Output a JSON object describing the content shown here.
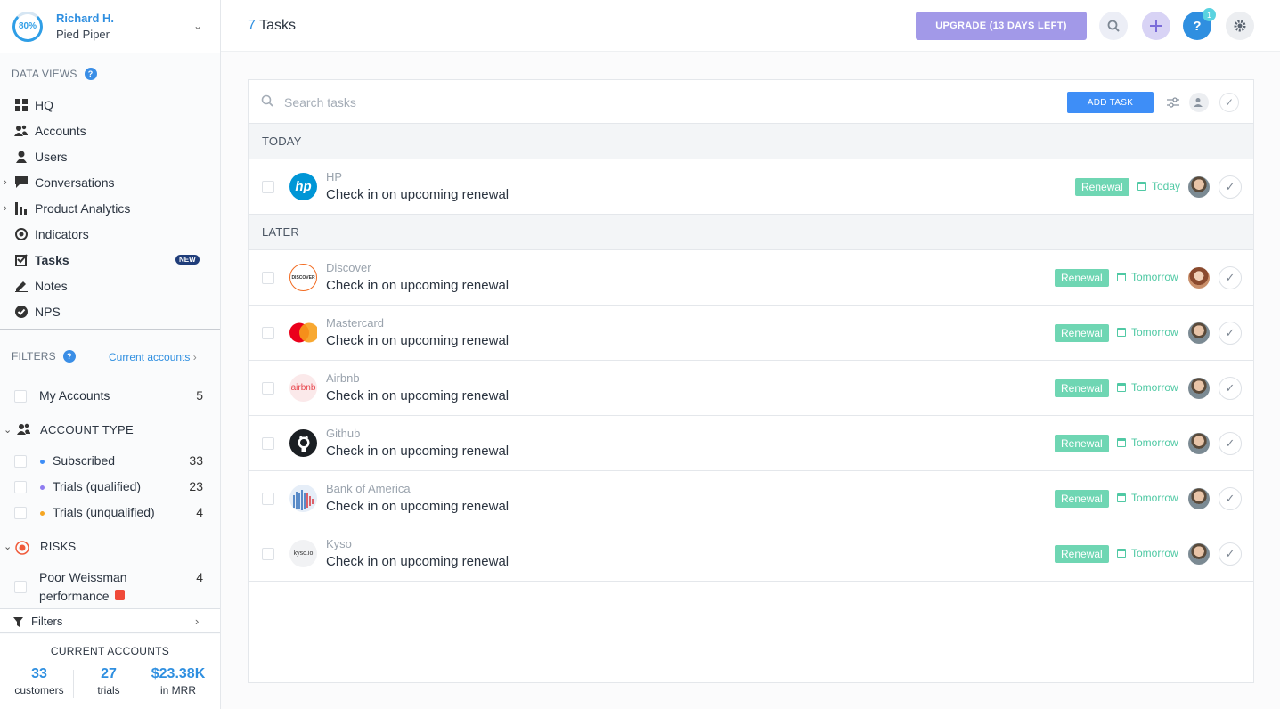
{
  "profile": {
    "progress": "80%",
    "name": "Richard H.",
    "company": "Pied Piper"
  },
  "sidebar": {
    "data_views_label": "DATA VIEWS",
    "help_glyph": "?",
    "items": [
      {
        "label": "HQ",
        "icon": "grid-icon"
      },
      {
        "label": "Accounts",
        "icon": "accounts-icon"
      },
      {
        "label": "Users",
        "icon": "user-icon"
      },
      {
        "label": "Conversations",
        "icon": "chat-icon"
      },
      {
        "label": "Product Analytics",
        "icon": "bar-chart-icon"
      },
      {
        "label": "Indicators",
        "icon": "target-icon"
      },
      {
        "label": "Tasks",
        "icon": "checkbox-icon",
        "badge": "NEW"
      },
      {
        "label": "Notes",
        "icon": "pencil-icon"
      },
      {
        "label": "NPS",
        "icon": "check-circle-icon"
      }
    ],
    "filters_label": "FILTERS",
    "current_accounts_link": "Current accounts",
    "my_accounts": {
      "label": "My Accounts",
      "count": "5"
    },
    "account_type": {
      "label": "ACCOUNT TYPE",
      "options": [
        {
          "label": "Subscribed",
          "count": "33",
          "color": "#3e8ef7"
        },
        {
          "label": "Trials (qualified)",
          "count": "23",
          "color": "#8e7cf0"
        },
        {
          "label": "Trials (unqualified)",
          "count": "4",
          "color": "#f5a623"
        }
      ]
    },
    "risks": {
      "label": "RISKS",
      "options": [
        {
          "label_line1": "Poor Weissman",
          "label_line2": "performance",
          "count": "4"
        }
      ]
    },
    "filters_button": "Filters",
    "summary": {
      "title": "CURRENT ACCOUNTS",
      "customers": {
        "value": "33",
        "label": "customers"
      },
      "trials": {
        "value": "27",
        "label": "trials"
      },
      "mrr": {
        "value": "$23.38K",
        "label": "in MRR"
      }
    }
  },
  "header": {
    "task_count": "7",
    "title": "Tasks",
    "upgrade": "UPGRADE (13 DAYS LEFT)",
    "notifications": "1",
    "help_glyph": "?"
  },
  "panel": {
    "search_placeholder": "Search tasks",
    "add_task": "ADD TASK",
    "groups": {
      "today": "TODAY",
      "later": "LATER"
    },
    "tasks": [
      {
        "account": "HP",
        "title": "Check in on upcoming renewal",
        "tag": "Renewal",
        "due": "Today"
      },
      {
        "account": "Discover",
        "title": "Check in on upcoming renewal",
        "tag": "Renewal",
        "due": "Tomorrow"
      },
      {
        "account": "Mastercard",
        "title": "Check in on upcoming renewal",
        "tag": "Renewal",
        "due": "Tomorrow"
      },
      {
        "account": "Airbnb",
        "title": "Check in on upcoming renewal",
        "tag": "Renewal",
        "due": "Tomorrow"
      },
      {
        "account": "Github",
        "title": "Check in on upcoming renewal",
        "tag": "Renewal",
        "due": "Tomorrow"
      },
      {
        "account": "Bank of America",
        "title": "Check in on upcoming renewal",
        "tag": "Renewal",
        "due": "Tomorrow"
      },
      {
        "account": "Kyso",
        "title": "Check in on upcoming renewal",
        "tag": "Renewal",
        "due": "Tomorrow"
      }
    ],
    "logos": {
      "hp": "hp",
      "discover": "DISCOVER",
      "airbnb": "airbnb",
      "kyso": "kyso.io"
    }
  },
  "colors": {
    "accent": "#2f8fe0",
    "tag": "#6fd6b3",
    "upgrade": "#a299e8",
    "add_task": "#3e8ef7"
  }
}
